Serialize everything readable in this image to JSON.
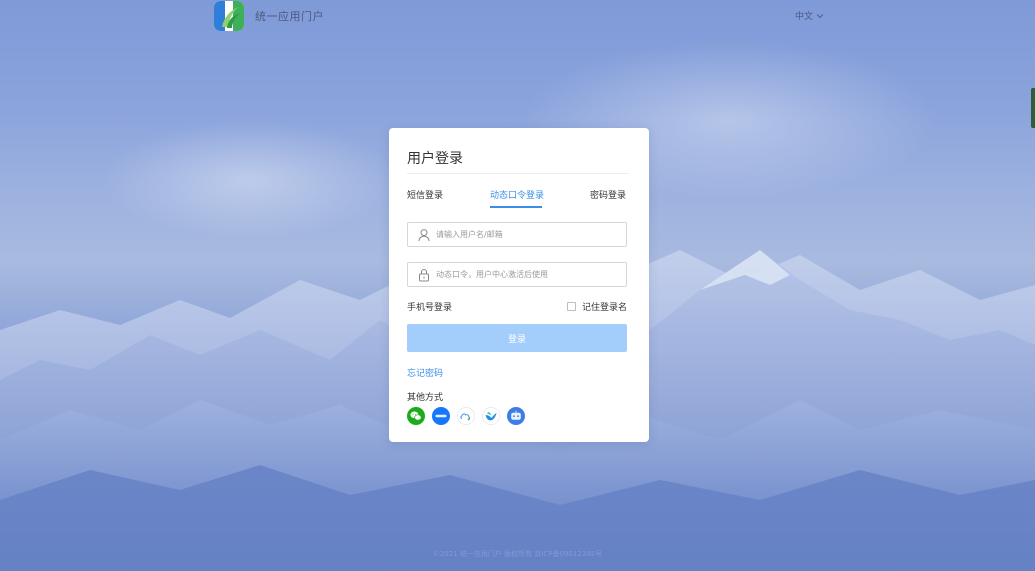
{
  "header": {
    "portal_title": "统一应用门户",
    "language": "中文"
  },
  "login": {
    "title": "用户登录",
    "tabs": [
      {
        "label": "短信登录"
      },
      {
        "label": "动态口令登录"
      },
      {
        "label": "密码登录"
      }
    ],
    "active_tab_index": 1,
    "username_placeholder": "请输入用户名/邮箱",
    "token_placeholder": "动态口令，用户中心激活后使用",
    "phone_login_label": "手机号登录",
    "remember_label": "记住登录名",
    "submit_label": "登录",
    "forgot_label": "忘记密码",
    "other_methods_label": "其他方式",
    "social_icons": [
      "wechat-icon",
      "welink-icon",
      "cloud-icon",
      "bird-icon",
      "robot-icon"
    ]
  },
  "footer": {
    "text": "©2021 统一应用门户 版权所有 京ICP备09012345号"
  },
  "colors": {
    "accent": "#3a8ee6",
    "button_disabled": "#a3cdfb",
    "wechat": "#1aad19",
    "welink": "#1677ff"
  }
}
